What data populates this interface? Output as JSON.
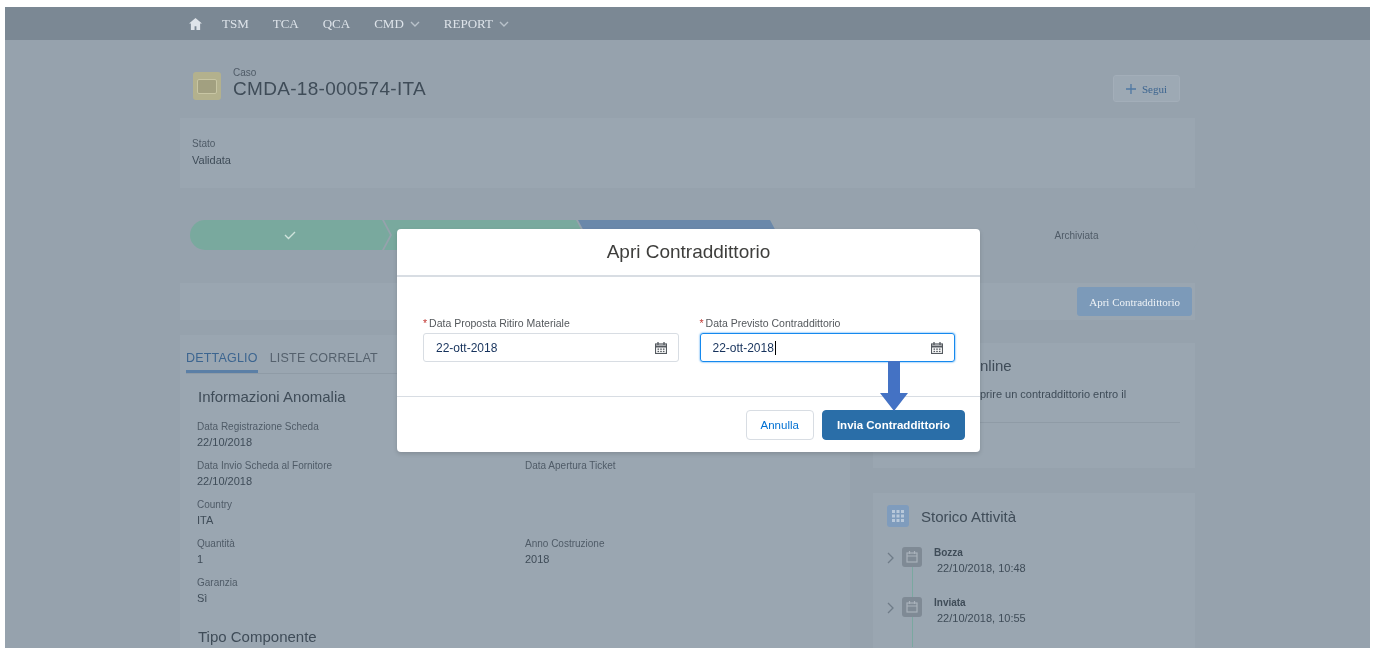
{
  "nav": {
    "items": [
      {
        "label": "TSM",
        "dropdown": false
      },
      {
        "label": "TCA",
        "dropdown": false
      },
      {
        "label": "QCA",
        "dropdown": false
      },
      {
        "label": "CMD",
        "dropdown": true
      },
      {
        "label": "REPORT",
        "dropdown": true
      }
    ]
  },
  "record": {
    "type_label": "Caso",
    "title": "CMDA-18-000574-ITA",
    "follow_button": "Segui"
  },
  "highlights": [
    {
      "label": "Stato",
      "value": "Validata"
    }
  ],
  "path": {
    "stages": [
      {
        "kind": "complete",
        "check": true
      },
      {
        "kind": "complete"
      },
      {
        "kind": "current"
      },
      {
        "kind": "upcoming",
        "check": false,
        "label": "Archiviata"
      }
    ]
  },
  "action_button": "Apri Contraddittorio",
  "tabs": [
    {
      "label": "DETTAGLIO",
      "selected": true
    },
    {
      "label": "LISTE CORRELAT",
      "selected": false
    }
  ],
  "detail": {
    "section": "Informazioni Anomalia",
    "rows": [
      {
        "left": {
          "label": "Data Registrazione Scheda",
          "value": "22/10/2018"
        }
      },
      {
        "left": {
          "label": "Data Invio Scheda al Fornitore",
          "value": "22/10/2018"
        },
        "right": {
          "label": "Data Apertura Ticket"
        }
      },
      {
        "left": {
          "label": "Country",
          "value": "ITA"
        }
      },
      {
        "left": {
          "label": "Quantità",
          "value": "1"
        },
        "right": {
          "label": "Anno Costruzione",
          "value": "2018"
        }
      },
      {
        "left": {
          "label": "Garanzia",
          "value": "Sì"
        }
      }
    ],
    "section_2": "Tipo Componente"
  },
  "online_card": {
    "title": "nline",
    "text": "prire un contraddittorio entro il"
  },
  "activity": {
    "title": "Storico Attività",
    "items": [
      {
        "name": "Bozza",
        "time": "22/10/2018, 10:48"
      },
      {
        "name": "Inviata",
        "time": "22/10/2018, 10:55"
      }
    ]
  },
  "modal": {
    "title": "Apri Contraddittorio",
    "fields": [
      {
        "label": "Data Proposta Ritiro Materiale",
        "required_mark": "*",
        "value": "22-ott-2018",
        "focused": false
      },
      {
        "label": "Data Previsto Contraddittorio",
        "required_mark": "*",
        "value": "22-ott-2018",
        "focused": true
      }
    ],
    "buttons": [
      {
        "label": "Annulla",
        "kind": "neutral"
      },
      {
        "label": "Invia Contraddittorio",
        "kind": "brand"
      }
    ]
  }
}
